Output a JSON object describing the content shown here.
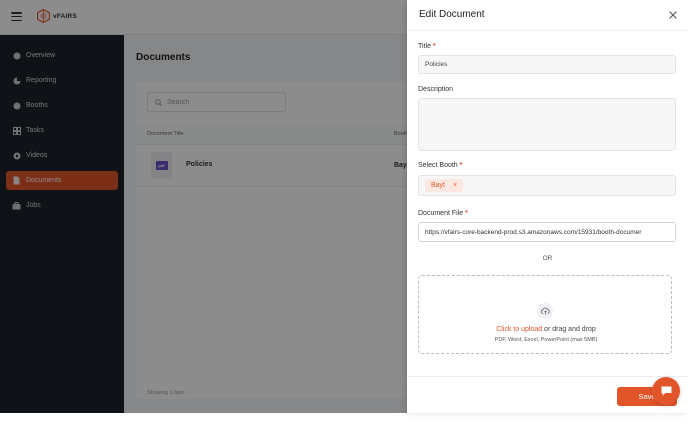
{
  "topbar": {
    "logo_text": "vFAIRS"
  },
  "sidebar": {
    "items": [
      {
        "label": "Overview",
        "icon": "overview-icon",
        "active": false
      },
      {
        "label": "Reporting",
        "icon": "reporting-icon",
        "active": false
      },
      {
        "label": "Booths",
        "icon": "booths-icon",
        "active": false
      },
      {
        "label": "Tasks",
        "icon": "tasks-icon",
        "active": false
      },
      {
        "label": "Videos",
        "icon": "videos-icon",
        "active": false
      },
      {
        "label": "Documents",
        "icon": "documents-icon",
        "active": true
      },
      {
        "label": "Jobs",
        "icon": "jobs-icon",
        "active": false
      }
    ]
  },
  "main": {
    "page_title": "Documents",
    "search_placeholder": "Search",
    "columns": [
      "Document Title",
      "Booth"
    ],
    "rows": [
      {
        "thumb": "pdf",
        "title": "Policies",
        "booth": "Bayt"
      }
    ],
    "showing": "Showing 1 item"
  },
  "drawer": {
    "title": "Edit Document",
    "title_label": "Title",
    "title_value": "Policies",
    "description_label": "Description",
    "description_value": "",
    "booth_label": "Select Booth",
    "booth_tag": "Bayt",
    "booth_tag_remove": "×",
    "file_label": "Document File",
    "file_url": "https://vfairs-core-backend-prod.s3.amazonaws.com/15931/booth-documer",
    "or_text": "OR",
    "upload_link": "Click to upload",
    "upload_rest": " or drag and drop",
    "upload_types": "PDF, Word, Excel, PowerPoint (max 5MB)",
    "required_mark": "*",
    "save_label": "Save"
  },
  "colors": {
    "accent": "#e2552b",
    "sidebar_bg": "#1c2229",
    "pdf_badge": "#6a4fc7"
  }
}
